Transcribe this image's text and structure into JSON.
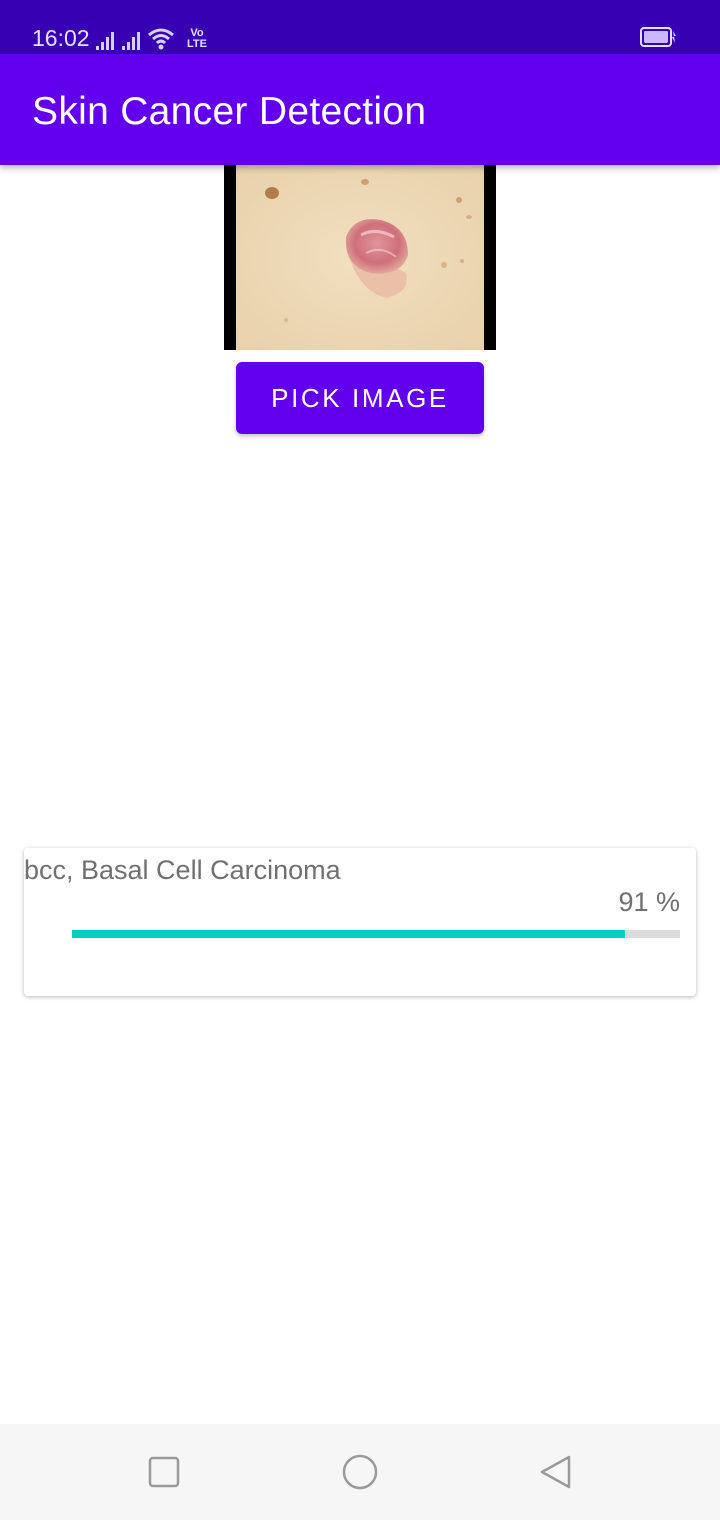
{
  "status_bar": {
    "time": "16:02",
    "network_label": "Vo LTE",
    "icons": [
      "signal-icon",
      "signal-icon",
      "wifi-icon",
      "volte-icon",
      "battery-charging-icon"
    ]
  },
  "app_bar": {
    "title": "Skin Cancer Detection",
    "color": "#6200ee"
  },
  "image": {
    "icon": "skin-lesion-photo"
  },
  "pick_button": {
    "label": "PICK IMAGE"
  },
  "result": {
    "label": "bcc, Basal Cell Carcinoma",
    "percent_text": "91 %",
    "progress_percent": 91,
    "bar_color": "#00cfc6"
  },
  "nav_bar": {
    "icons": [
      "recents-square-icon",
      "home-circle-icon",
      "back-triangle-icon"
    ]
  }
}
